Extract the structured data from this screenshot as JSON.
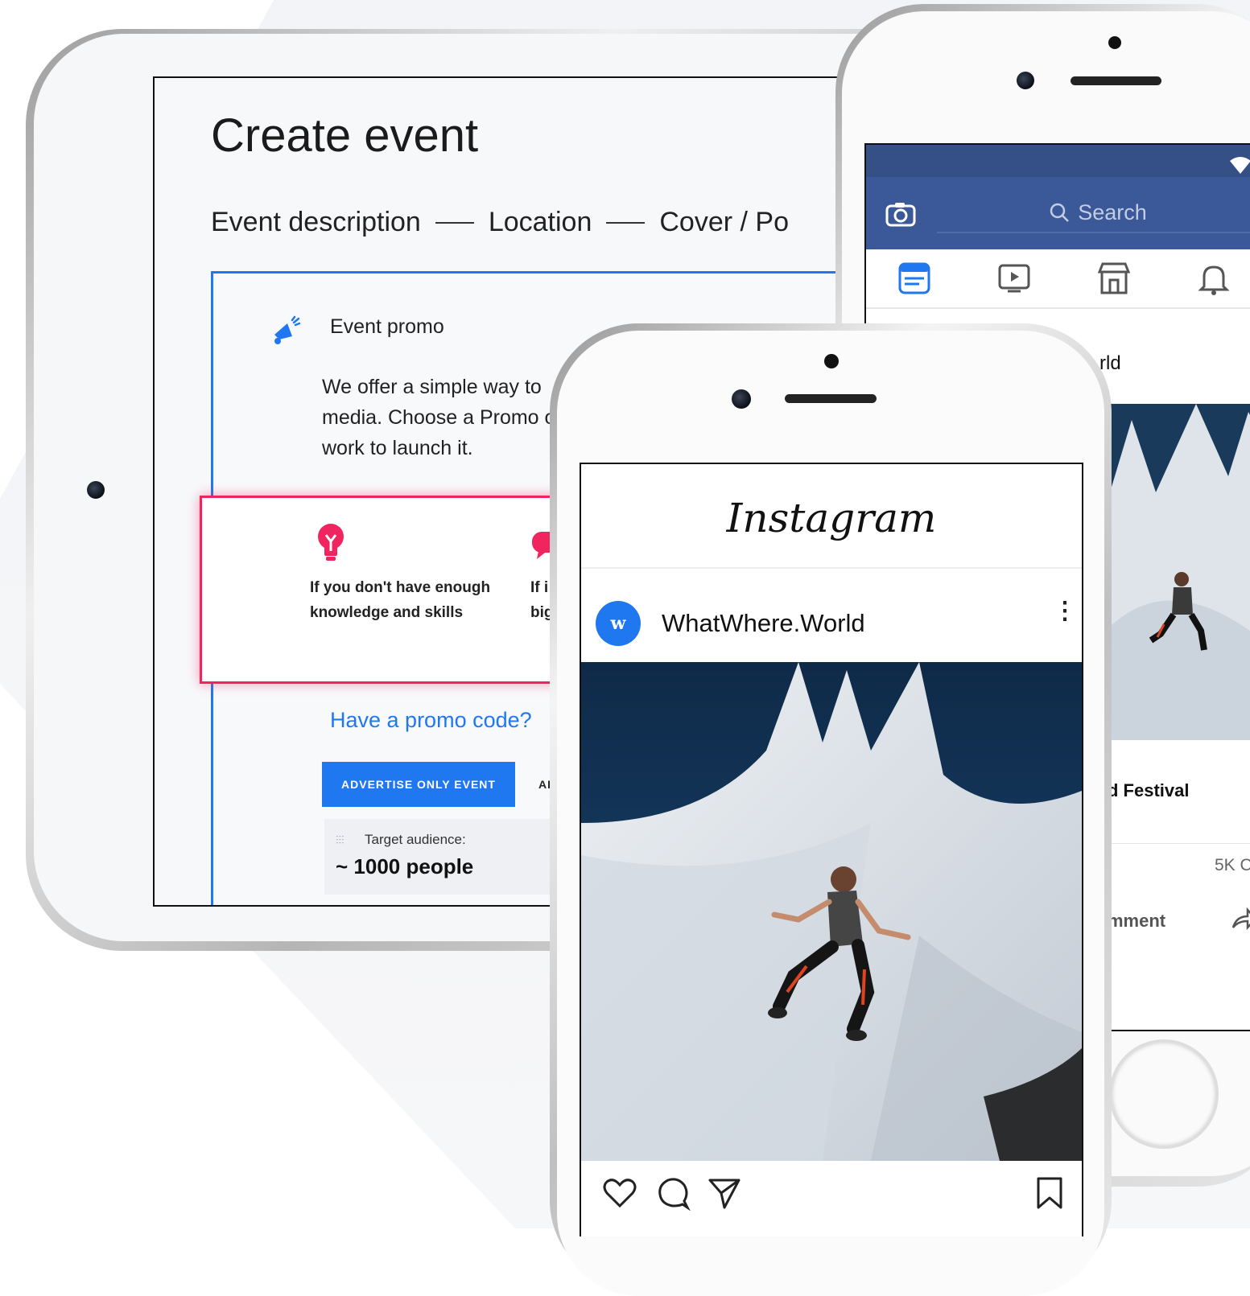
{
  "tablet": {
    "page_title": "Create event",
    "steps": [
      "Event description",
      "Location",
      "Cover / Po"
    ],
    "promo": {
      "icon": "megaphone-icon",
      "title": "Event promo",
      "description": "We offer a simple way to media. Choose a Promo of work to launch it.",
      "option_1": {
        "icon": "lightbulb-icon",
        "text": "If you don't have enough knowledge and skills"
      },
      "option_2": {
        "icon": "chat-bubble-icon",
        "text": "If i big"
      },
      "promo_code_link": "Have a promo code?",
      "advertise_button": "ADVERTISE ONLY EVENT",
      "advertise_button_2": "AD",
      "audience_label": "Target audience:",
      "audience_value": "~ 1000 people"
    }
  },
  "facebook": {
    "search_placeholder": "Search",
    "tabs": [
      "news-feed-icon",
      "video-icon",
      "marketplace-icon",
      "bell-icon"
    ],
    "page_name_fragment": "rld",
    "event_title_fragment": "d Festival",
    "count_fragment": "5K C",
    "comment_fragment": "mment"
  },
  "instagram": {
    "logo": "Instagram",
    "avatar_letter": "w",
    "username": "WhatWhere.World",
    "more": "⋮",
    "actions": [
      "heart-icon",
      "comment-icon",
      "send-icon",
      "bookmark-icon"
    ]
  },
  "colors": {
    "accent_blue": "#1f78f0",
    "accent_pink": "#f0245e",
    "facebook_blue": "#3b5998"
  }
}
